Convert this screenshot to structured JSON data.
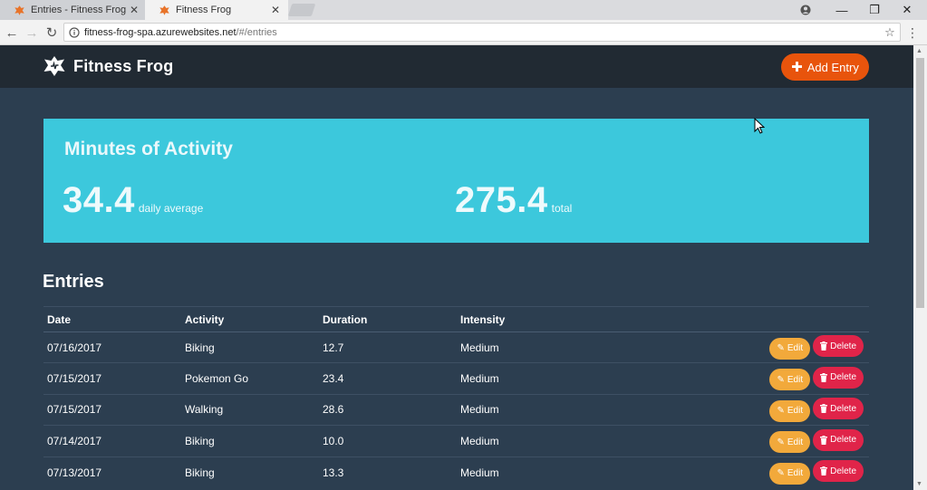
{
  "browser": {
    "tabs": [
      {
        "title": "Entries - Fitness Frog",
        "active": false
      },
      {
        "title": "Fitness Frog",
        "active": true
      }
    ],
    "url_host": "fitness-frog-spa.azurewebsites.net",
    "url_path": "/#/entries"
  },
  "header": {
    "brand": "Fitness Frog",
    "add_entry_label": "Add Entry"
  },
  "activity": {
    "heading": "Minutes of Activity",
    "average_value": "34.4",
    "average_label": "daily average",
    "total_value": "275.4",
    "total_label": "total"
  },
  "entries": {
    "heading": "Entries",
    "columns": [
      "Date",
      "Activity",
      "Duration",
      "Intensity"
    ],
    "edit_label": "Edit",
    "delete_label": "Delete",
    "rows": [
      {
        "date": "07/16/2017",
        "activity": "Biking",
        "duration": "12.7",
        "intensity": "Medium"
      },
      {
        "date": "07/15/2017",
        "activity": "Pokemon Go",
        "duration": "23.4",
        "intensity": "Medium"
      },
      {
        "date": "07/15/2017",
        "activity": "Walking",
        "duration": "28.6",
        "intensity": "Medium"
      },
      {
        "date": "07/14/2017",
        "activity": "Biking",
        "duration": "10.0",
        "intensity": "Medium"
      },
      {
        "date": "07/13/2017",
        "activity": "Biking",
        "duration": "13.3",
        "intensity": "Medium"
      }
    ]
  },
  "colors": {
    "page_bg": "#2c3e50",
    "header_bg": "#212a33",
    "accent_orange": "#e8540c",
    "panel_cyan": "#3cc8dc",
    "edit_yellow": "#f2a93b",
    "delete_red": "#e02449"
  }
}
